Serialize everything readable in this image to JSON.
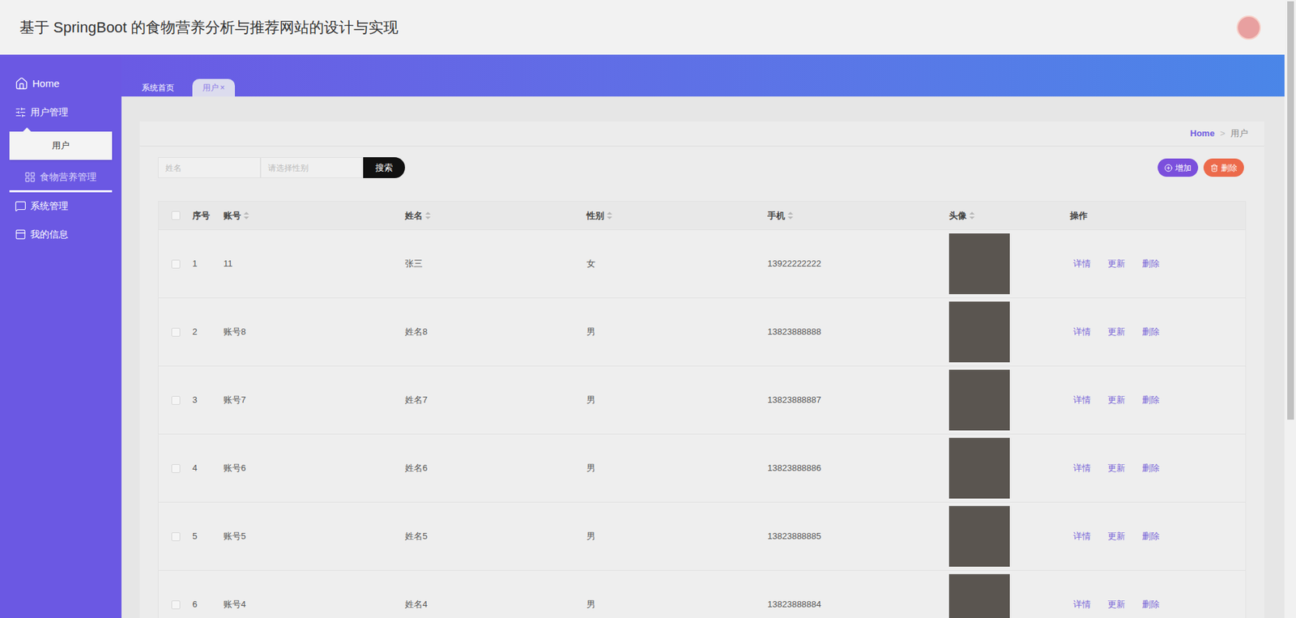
{
  "header": {
    "title": "基于 SpringBoot 的食物营养分析与推荐网站的设计与实现"
  },
  "sidebar": {
    "items": [
      {
        "label": "Home",
        "icon": "home",
        "expanded": false,
        "hovered": false,
        "children": []
      },
      {
        "label": "用户管理",
        "icon": "sliders",
        "expanded": true,
        "hovered": false,
        "children": [
          {
            "label": "用户",
            "selected": true
          }
        ]
      },
      {
        "label": "食物营养管理",
        "icon": "grid",
        "expanded": false,
        "hovered": true,
        "children": []
      },
      {
        "label": "系统管理",
        "icon": "message",
        "expanded": false,
        "hovered": false,
        "children": []
      },
      {
        "label": "我的信息",
        "icon": "card",
        "expanded": false,
        "hovered": false,
        "children": []
      }
    ]
  },
  "tabs": [
    {
      "label": "系统首页",
      "selected": false,
      "close": ""
    },
    {
      "label": "用户",
      "selected": true,
      "close": "×"
    }
  ],
  "breadcrumb": {
    "items": [
      "Home",
      "用户"
    ],
    "separator": ">"
  },
  "search": {
    "name_placeholder": "姓名",
    "gender_placeholder": "请选择性别",
    "button": "搜索"
  },
  "actions": [
    {
      "label": "增加",
      "kind": "add"
    },
    {
      "label": "删除",
      "kind": "delete"
    }
  ],
  "table": {
    "header_checked": false,
    "columns": [
      {
        "label": "序号",
        "sortable": false
      },
      {
        "label": "账号",
        "sortable": true
      },
      {
        "label": "姓名",
        "sortable": true
      },
      {
        "label": "性别",
        "sortable": true
      },
      {
        "label": "手机",
        "sortable": true
      },
      {
        "label": "头像",
        "sortable": true
      },
      {
        "label": "操作",
        "sortable": false
      }
    ],
    "rows": [
      {
        "index": "1",
        "account": "11",
        "name": "张三",
        "gender": "女",
        "phone": "13922222222",
        "checked": false,
        "actions": [
          "详情",
          "更新",
          "删除"
        ]
      },
      {
        "index": "2",
        "account": "账号8",
        "name": "姓名8",
        "gender": "男",
        "phone": "13823888888",
        "checked": false,
        "actions": [
          "详情",
          "更新",
          "删除"
        ]
      },
      {
        "index": "3",
        "account": "账号7",
        "name": "姓名7",
        "gender": "男",
        "phone": "13823888887",
        "checked": false,
        "actions": [
          "详情",
          "更新",
          "删除"
        ]
      },
      {
        "index": "4",
        "account": "账号6",
        "name": "姓名6",
        "gender": "男",
        "phone": "13823888886",
        "checked": false,
        "actions": [
          "详情",
          "更新",
          "删除"
        ]
      },
      {
        "index": "5",
        "account": "账号5",
        "name": "姓名5",
        "gender": "男",
        "phone": "13823888885",
        "checked": false,
        "actions": [
          "详情",
          "更新",
          "删除"
        ]
      },
      {
        "index": "6",
        "account": "账号4",
        "name": "姓名4",
        "gender": "男",
        "phone": "13823888884",
        "checked": false,
        "actions": [
          "详情",
          "更新",
          "删除"
        ]
      }
    ]
  }
}
